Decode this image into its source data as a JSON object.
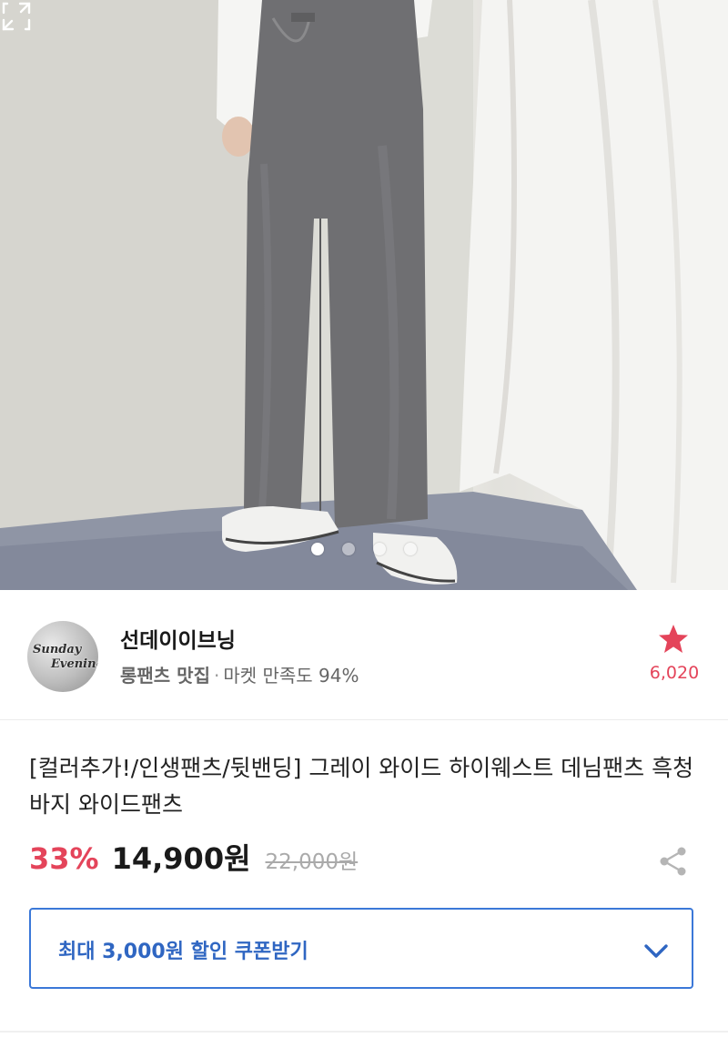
{
  "gallery": {
    "slide_count": 4,
    "active_index": 0,
    "expand_icon": "expand-icon"
  },
  "seller": {
    "avatar_line1": "Sunday",
    "avatar_line2": "Evening",
    "name": "선데이이브닝",
    "tag": "롱팬츠 맛집",
    "separator": "·",
    "satisfaction": "마켓 만족도 94%",
    "favorite_count": "6,020",
    "star_color": "#e4445a"
  },
  "product": {
    "title": "[컬러추가!/인생팬츠/뒷밴딩] 그레이 와이드 하이웨스트 데님팬츠 흑청바지 와이드팬츠",
    "discount": "33%",
    "price": "14,900원",
    "original_price": "22,000원",
    "accent_color": "#e4445a"
  },
  "coupon": {
    "label": "최대 3,000원 할인 쿠폰받기",
    "color": "#3b78d8"
  }
}
